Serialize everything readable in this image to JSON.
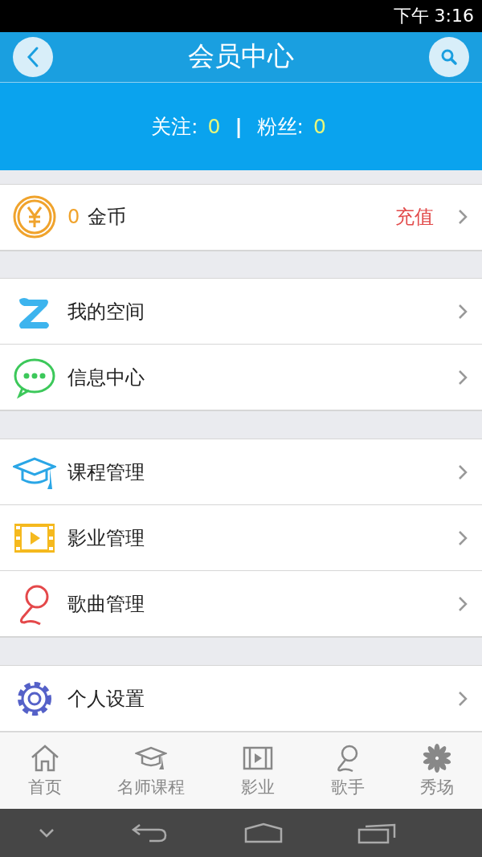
{
  "status_bar": {
    "time": "下午 3:16"
  },
  "header": {
    "title": "会员中心"
  },
  "stats": {
    "following_label": "关注:",
    "following_value": "0",
    "separator": "|",
    "fans_label": "粉丝:",
    "fans_value": "0"
  },
  "wallet": {
    "amount": "0",
    "unit": "金币",
    "action": "充值"
  },
  "menu_groups": [
    [
      {
        "label": "我的空间"
      },
      {
        "label": "信息中心"
      }
    ],
    [
      {
        "label": "课程管理"
      },
      {
        "label": "影业管理"
      },
      {
        "label": "歌曲管理"
      }
    ],
    [
      {
        "label": "个人设置"
      }
    ]
  ],
  "tabs": [
    {
      "label": "首页",
      "selected": false
    },
    {
      "label": "名师课程",
      "selected": false
    },
    {
      "label": "影业",
      "selected": false
    },
    {
      "label": "歌手",
      "selected": false
    },
    {
      "label": "秀场",
      "selected": false
    }
  ]
}
